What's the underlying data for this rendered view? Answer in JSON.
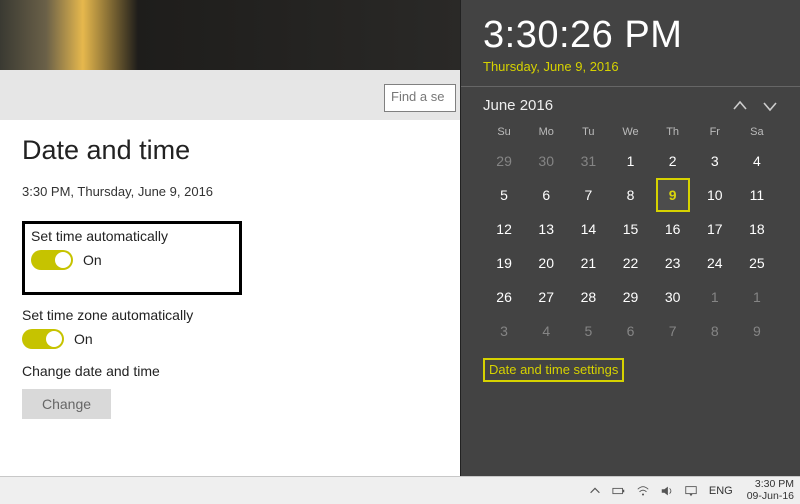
{
  "header": {
    "search_placeholder": "Find a se"
  },
  "settings": {
    "title": "Date and time",
    "current": "3:30 PM, Thursday, June 9, 2016",
    "set_time_auto": {
      "label": "Set time automatically",
      "state": "On"
    },
    "set_tz_auto": {
      "label": "Set time zone automatically",
      "state": "On"
    },
    "change_section_label": "Change date and time",
    "change_button": "Change"
  },
  "flyout": {
    "time": "3:30:26 PM",
    "date_long": "Thursday, June 9, 2016",
    "month_label": "June 2016",
    "dow": [
      "Su",
      "Mo",
      "Tu",
      "We",
      "Th",
      "Fr",
      "Sa"
    ],
    "cells": [
      {
        "n": 29,
        "dim": true
      },
      {
        "n": 30,
        "dim": true
      },
      {
        "n": 31,
        "dim": true
      },
      {
        "n": 1
      },
      {
        "n": 2
      },
      {
        "n": 3
      },
      {
        "n": 4
      },
      {
        "n": 5
      },
      {
        "n": 6
      },
      {
        "n": 7
      },
      {
        "n": 8
      },
      {
        "n": 9,
        "today": true
      },
      {
        "n": 10
      },
      {
        "n": 11
      },
      {
        "n": 12
      },
      {
        "n": 13
      },
      {
        "n": 14
      },
      {
        "n": 15
      },
      {
        "n": 16
      },
      {
        "n": 17
      },
      {
        "n": 18
      },
      {
        "n": 19
      },
      {
        "n": 20
      },
      {
        "n": 21
      },
      {
        "n": 22
      },
      {
        "n": 23
      },
      {
        "n": 24
      },
      {
        "n": 25
      },
      {
        "n": 26
      },
      {
        "n": 27
      },
      {
        "n": 28
      },
      {
        "n": 29
      },
      {
        "n": 30
      },
      {
        "n": 1,
        "dim": true
      },
      {
        "n": 1,
        "dim": true
      },
      {
        "n": 3,
        "dim": true
      },
      {
        "n": 4,
        "dim": true
      },
      {
        "n": 5,
        "dim": true
      },
      {
        "n": 6,
        "dim": true
      },
      {
        "n": 7,
        "dim": true
      },
      {
        "n": 8,
        "dim": true
      },
      {
        "n": 9,
        "dim": true
      }
    ],
    "settings_link": "Date and time settings"
  },
  "taskbar": {
    "lang": "ENG",
    "time": "3:30 PM",
    "date": "09-Jun-16"
  }
}
